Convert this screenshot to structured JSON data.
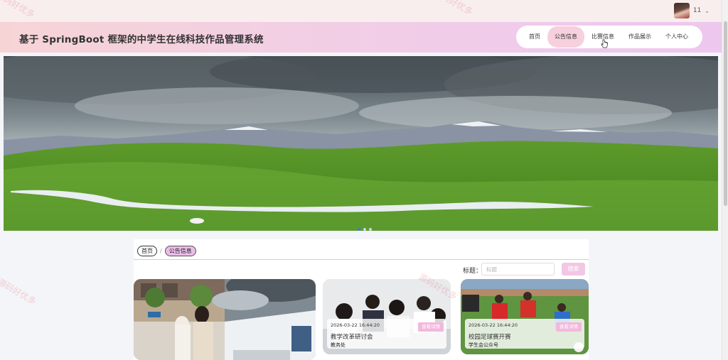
{
  "user": {
    "name": "11"
  },
  "header": {
    "title": "基于 SpringBoot 框架的中学生在线科技作品管理系统",
    "nav": [
      "首页",
      "公告信息",
      "比赛信息",
      "作品展示",
      "个人中心"
    ],
    "active_nav": "公告信息"
  },
  "breadcrumb": {
    "home": "首页",
    "separator": "/",
    "current": "公告信息"
  },
  "search": {
    "label": "标题：",
    "placeholder": "标题",
    "button": "搜索"
  },
  "notices": [
    {
      "date": "2026-03-22 16:44:20",
      "title": "教学改革研讨会",
      "publisher": "教务处",
      "button": "查看详情"
    },
    {
      "date": "2026-03-22 16:44:20",
      "title": "校园足球赛开赛",
      "publisher": "学生会公众号",
      "button": "查看详情"
    }
  ],
  "watermark": "源码好优多",
  "colors": {
    "accent": "#f2c7e4",
    "header_gradient_start": "#f6d4d6",
    "header_gradient_end": "#edc7ee",
    "active_nav": "#f7d0de"
  },
  "carousel": {
    "slides": 3,
    "active": 1
  }
}
